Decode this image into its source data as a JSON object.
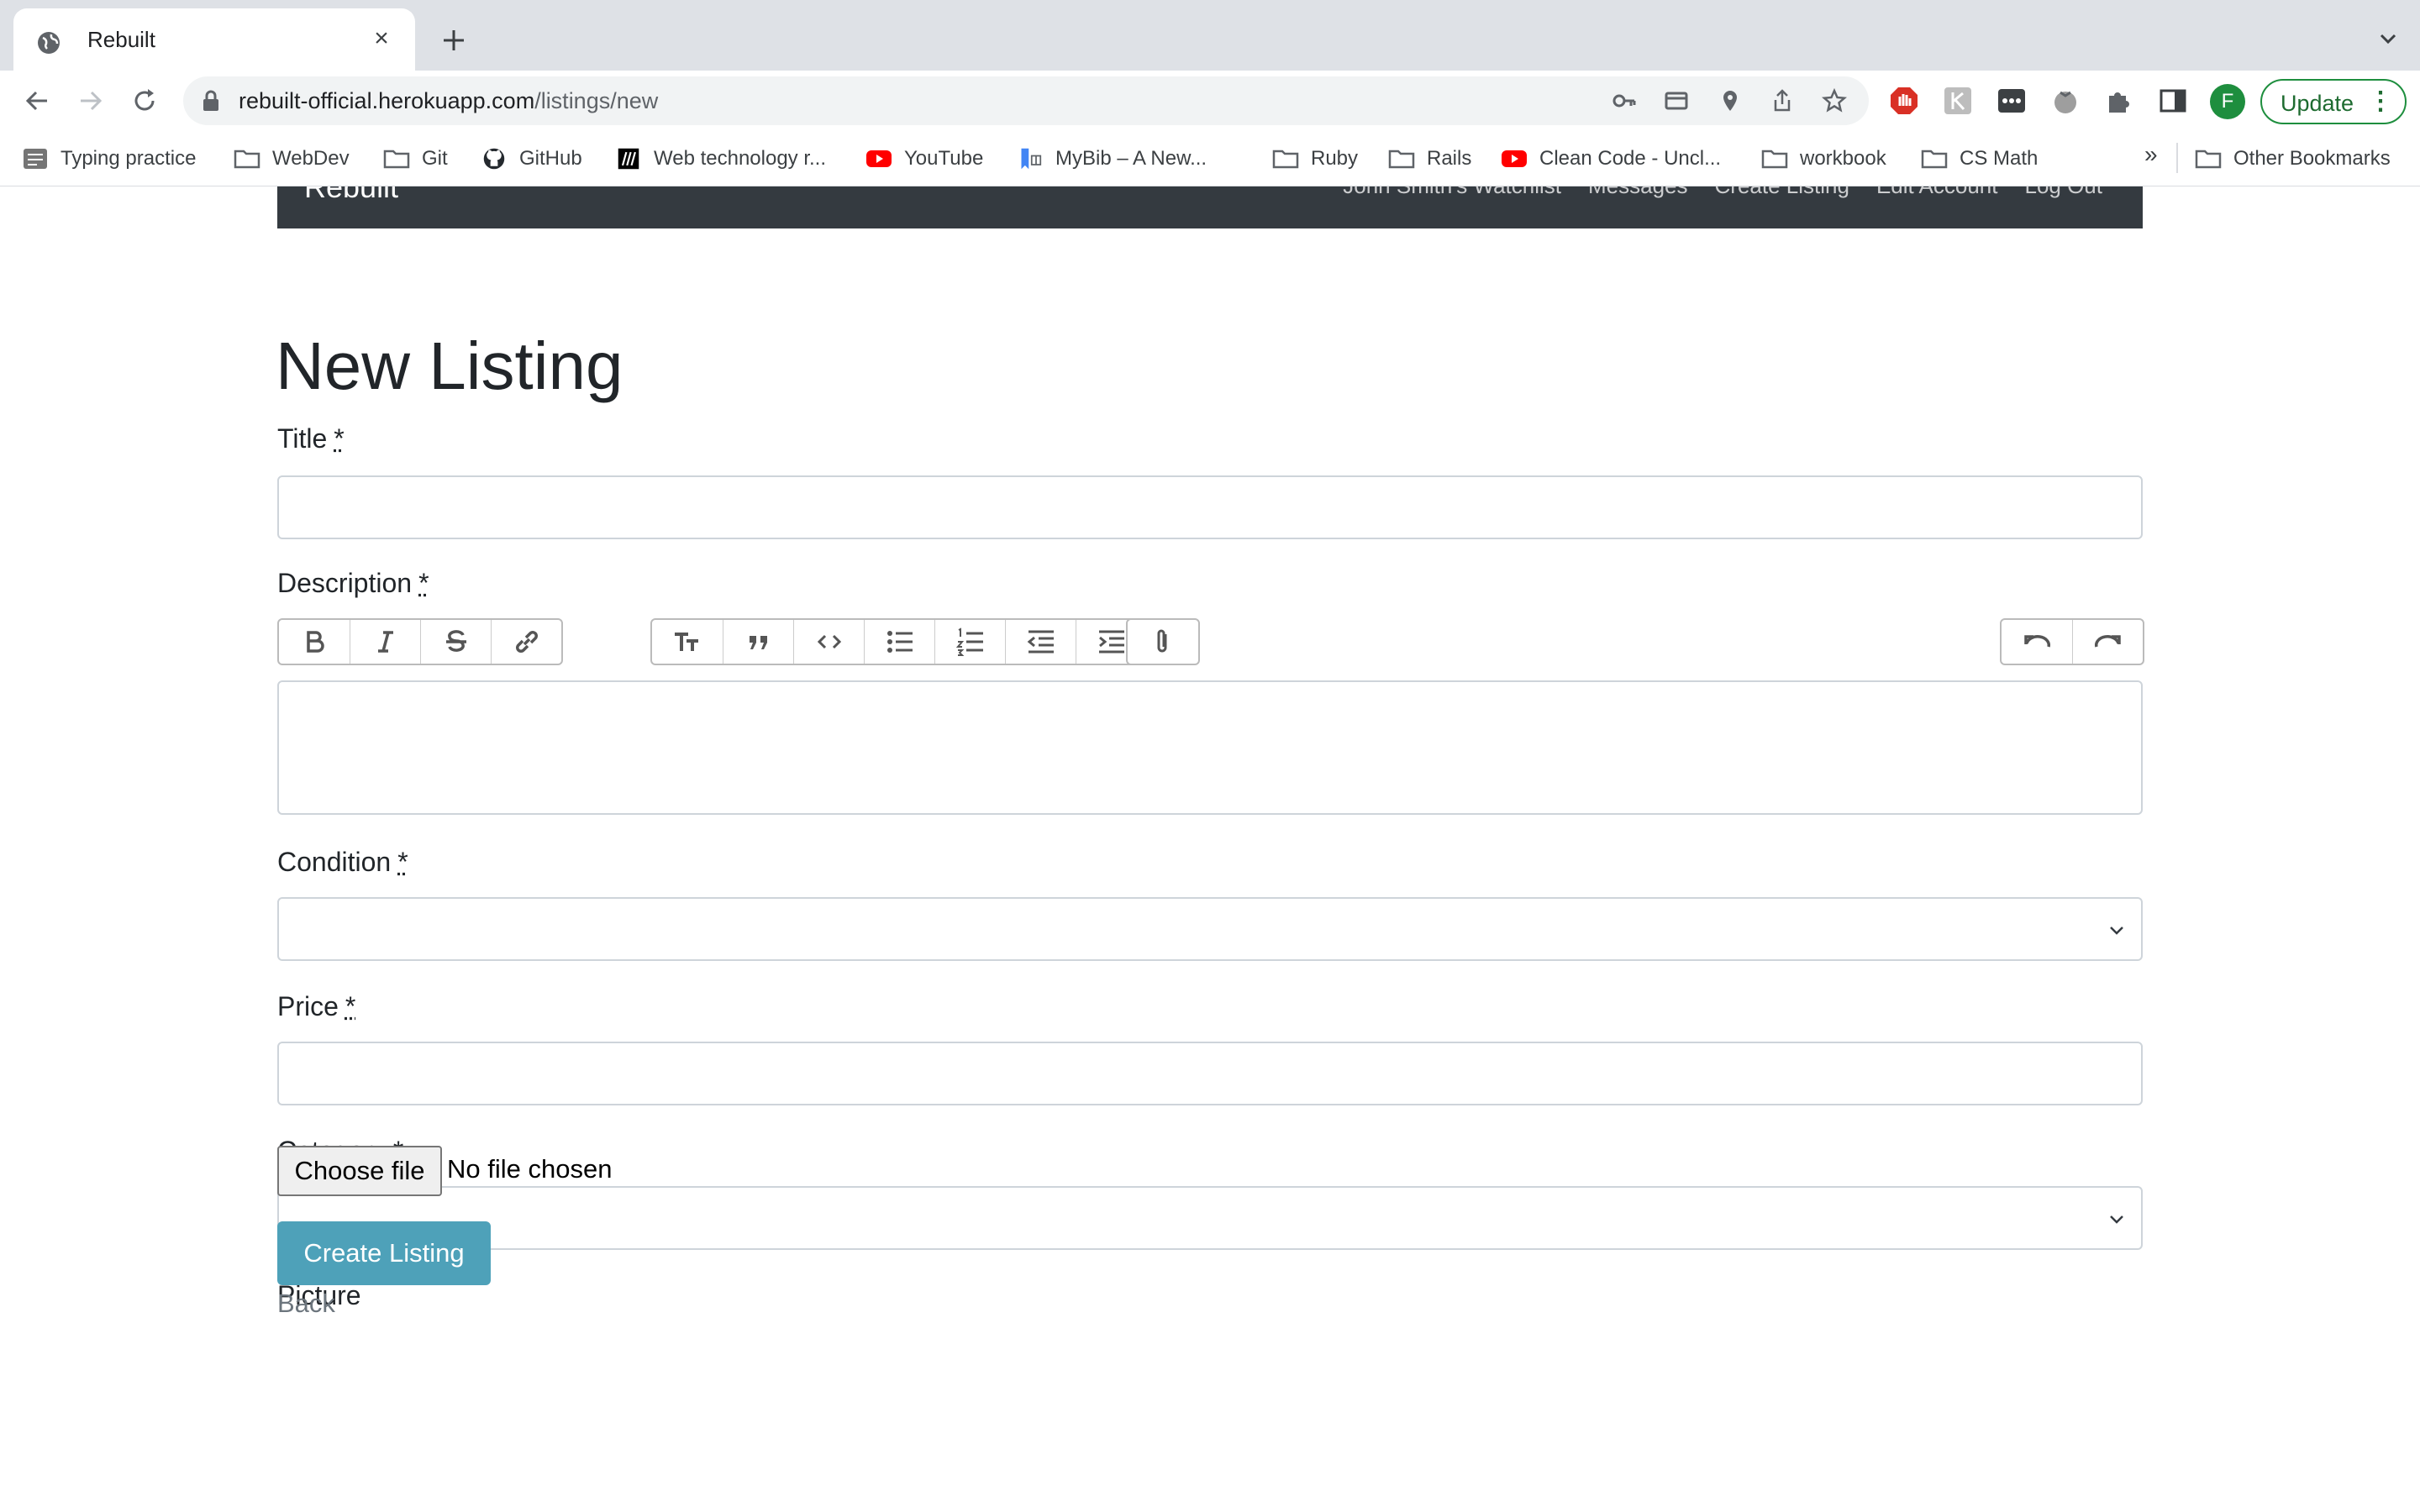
{
  "browser": {
    "tab_title": "Rebuilt",
    "url_host": "rebuilt-official.herokuapp.com",
    "url_path": "/listings/new",
    "profile_initial": "F",
    "update_label": "Update",
    "bookmarks": [
      {
        "label": "Typing practice",
        "icon": "typing-icon"
      },
      {
        "label": "WebDev",
        "icon": "folder-icon"
      },
      {
        "label": "Git",
        "icon": "folder-icon"
      },
      {
        "label": "GitHub",
        "icon": "github-icon"
      },
      {
        "label": "Web technology r...",
        "icon": "mdn-icon"
      },
      {
        "label": "YouTube",
        "icon": "youtube-icon"
      },
      {
        "label": "MyBib – A New...",
        "icon": "mybib-icon"
      },
      {
        "label": "Ruby",
        "icon": "folder-icon"
      },
      {
        "label": "Rails",
        "icon": "folder-icon"
      },
      {
        "label": "Clean Code - Uncl...",
        "icon": "youtube-icon"
      },
      {
        "label": "workbook",
        "icon": "folder-icon"
      },
      {
        "label": "CS Math",
        "icon": "folder-icon"
      }
    ],
    "bookmarks_overflow": "»",
    "other_bookmarks": "Other Bookmarks"
  },
  "site": {
    "brand": "Rebuilt",
    "nav": [
      "John Smith's Watchlist",
      "Messages",
      "Create Listing",
      "Edit Account",
      "Log Out"
    ]
  },
  "form": {
    "heading": "New Listing",
    "required_mark": "*",
    "title_label": "Title",
    "description_label": "Description",
    "condition_label": "Condition",
    "price_label": "Price",
    "category_label": "Category",
    "picture_label": "Picture",
    "file_button": "Choose file",
    "file_status": "No file chosen",
    "submit_label": "Create Listing",
    "back_link": "Back"
  },
  "colors": {
    "navbar": "#343a40",
    "submit": "#4ea1b9",
    "profile": "#1e8e3e"
  }
}
